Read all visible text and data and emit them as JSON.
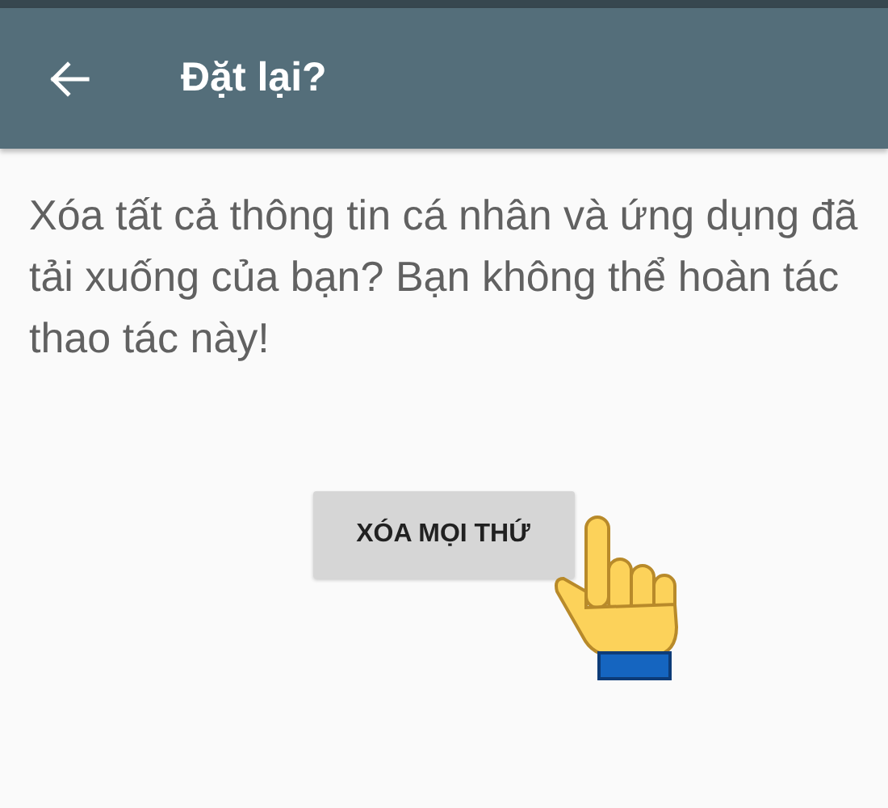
{
  "app_bar": {
    "title": "Đặt lại?"
  },
  "message": "Xóa tất cả thông tin cá nhân và ứng dụng đã tải xuống của bạn? Bạn không thể hoàn tác thao tác này!",
  "button": {
    "label": "XÓA MỌI THỨ"
  }
}
